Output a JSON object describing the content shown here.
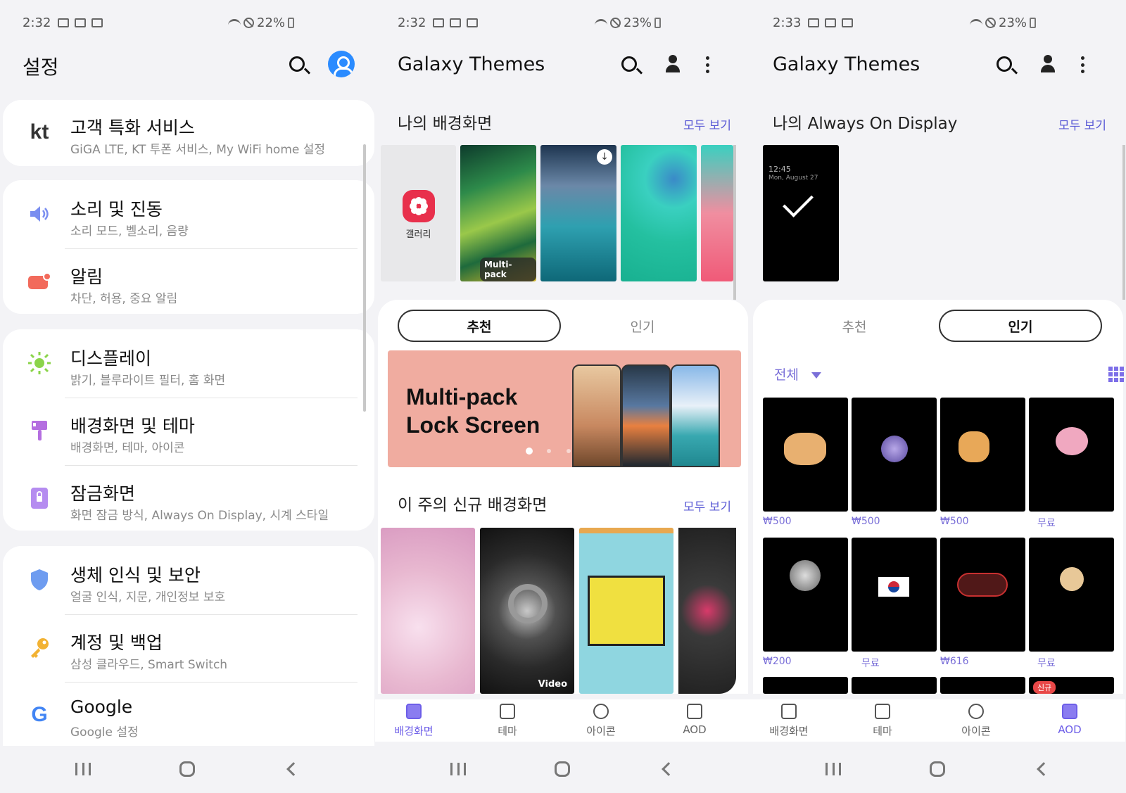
{
  "panel1": {
    "status": {
      "time": "2:32",
      "battery": "22%"
    },
    "title": "설정",
    "groups": [
      {
        "items": [
          {
            "title": "고객 특화 서비스",
            "subtitle": "GiGA LTE, KT 투폰 서비스, My WiFi home 설정",
            "icon": "kt-logo-icon"
          }
        ]
      },
      {
        "items": [
          {
            "title": "소리 및 진동",
            "subtitle": "소리 모드, 벨소리, 음량",
            "icon": "speaker-icon"
          },
          {
            "title": "알림",
            "subtitle": "차단, 허용, 중요 알림",
            "icon": "notification-icon"
          }
        ]
      },
      {
        "items": [
          {
            "title": "디스플레이",
            "subtitle": "밝기, 블루라이트 필터, 홈 화면",
            "icon": "sun-icon"
          },
          {
            "title": "배경화면 및 테마",
            "subtitle": "배경화면, 테마, 아이콘",
            "icon": "paintbrush-icon"
          },
          {
            "title": "잠금화면",
            "subtitle": "화면 잠금 방식, Always On Display, 시계 스타일",
            "icon": "lock-icon"
          }
        ]
      },
      {
        "items": [
          {
            "title": "생체 인식 및 보안",
            "subtitle": "얼굴 인식, 지문, 개인정보 보호",
            "icon": "shield-icon"
          },
          {
            "title": "계정 및 백업",
            "subtitle": "삼성 클라우드, Smart Switch",
            "icon": "key-icon"
          },
          {
            "title": "Google",
            "subtitle": "Google 설정",
            "icon": "google-icon"
          }
        ]
      }
    ]
  },
  "panel2": {
    "status": {
      "time": "2:32",
      "battery": "23%"
    },
    "title": "Galaxy Themes",
    "my_wallpapers": {
      "title": "나의 배경화면",
      "see_all": "모두 보기",
      "gallery_label": "갤러리",
      "multipack_badge": "Multi-pack"
    },
    "tabs": [
      "추천",
      "인기"
    ],
    "active_tab": 0,
    "banner": {
      "line1": "Multi-pack",
      "line2": "Lock Screen"
    },
    "new_wallpapers": {
      "title": "이 주의 신규 배경화면",
      "see_all": "모두 보기",
      "video_badge": "Video"
    },
    "bottom_tabs": [
      "배경화면",
      "테마",
      "아이콘",
      "AOD"
    ],
    "active_bottom": 0
  },
  "panel3": {
    "status": {
      "time": "2:33",
      "battery": "23%"
    },
    "title": "Galaxy Themes",
    "my_aod": {
      "title": "나의 Always On Display",
      "see_all": "모두 보기",
      "clock": "12:45",
      "date": "Mon, August 27"
    },
    "tabs": [
      "추천",
      "인기"
    ],
    "active_tab": 1,
    "filter": "전체",
    "prices": [
      "₩500",
      "₩500",
      "₩500",
      "무료",
      "₩200",
      "무료",
      "₩616",
      "무료"
    ],
    "new_badge": "신규",
    "bottom_tabs": [
      "배경화면",
      "테마",
      "아이콘",
      "AOD"
    ],
    "active_bottom": 3
  },
  "colors": {
    "accent": "#6d5ee8",
    "link": "#5b5bd6",
    "avatar": "#2a8bff",
    "banner": "#f0aca0"
  }
}
